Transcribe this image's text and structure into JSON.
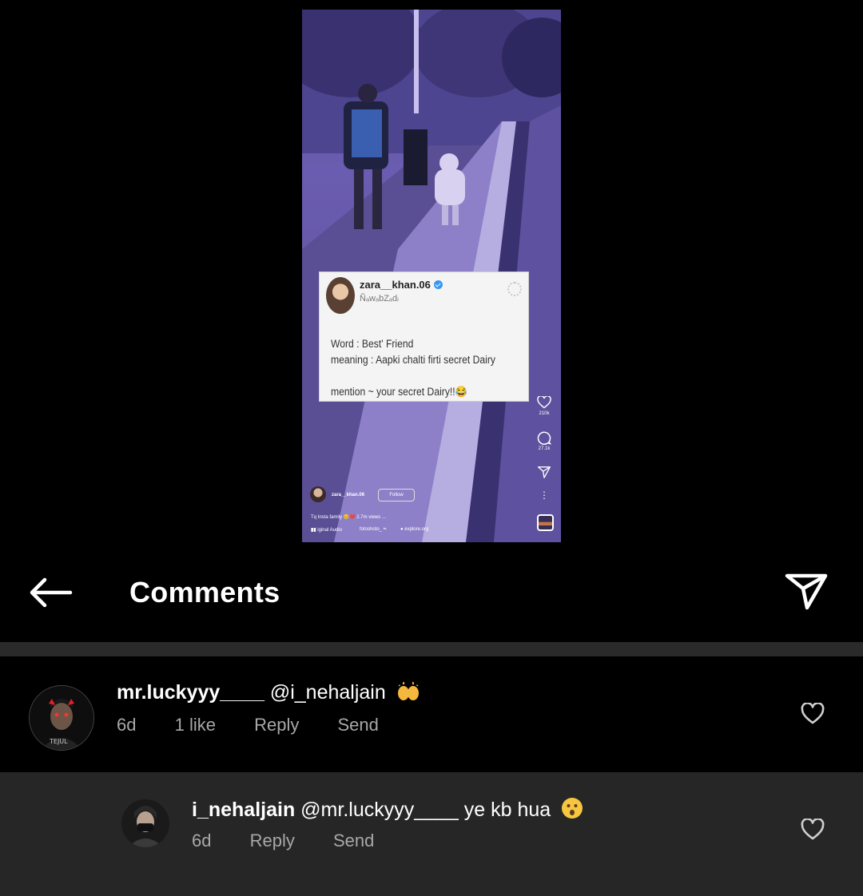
{
  "reel": {
    "card": {
      "username": "zara__khan.06",
      "bio": "ÑₐwₐbZₐdᵢ",
      "lines": [
        "Word : Best' Friend",
        "meaning : Aapki chalti firti secret Dairy",
        "mention ~ your secret Dairy!!😂"
      ]
    },
    "likes_count": "210k",
    "comments_count": "27.1k",
    "author": "zara__khan.06",
    "follow_label": "Follow",
    "caption": "Tq Insta family 😊❤️ 2.7m views ...",
    "audio": "iginal Audio",
    "audio_credit": "fotoshoto_ •‹",
    "location": "explore.org"
  },
  "header": {
    "title": "Comments"
  },
  "comments": [
    {
      "username": "mr.luckyyy____",
      "text": "@i_nehaljain",
      "emoji": "🙌",
      "time": "6d",
      "likes": "1 like",
      "reply_label": "Reply",
      "send_label": "Send"
    },
    {
      "username": "i_nehaljain",
      "text": "@mr.luckyyy____ ye kb hua",
      "emoji": "😯",
      "time": "6d",
      "reply_label": "Reply",
      "send_label": "Send"
    }
  ]
}
